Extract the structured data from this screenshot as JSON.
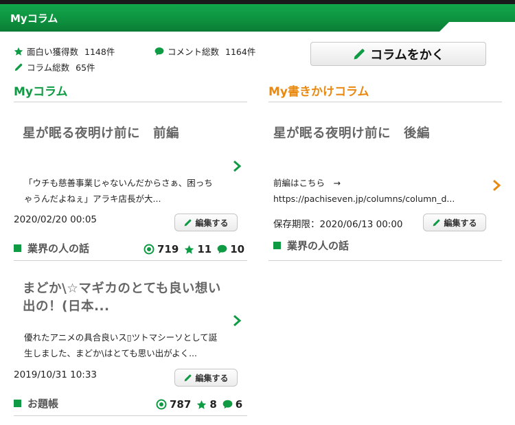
{
  "header": {
    "title": "Myコラム"
  },
  "stats": {
    "likes_label": "面白い獲得数",
    "likes_value": "1148件",
    "comments_label": "コメント総数",
    "comments_value": "1164件",
    "columns_label": "コラム総数",
    "columns_value": "65件"
  },
  "write_button": "コラムをかく",
  "my_columns": {
    "title": "Myコラム",
    "items": [
      {
        "title_line1": "星が眠る夜明け前に　前編",
        "title_line2": "",
        "excerpt_line1": "「ウチも慈善事業じゃないんだからさぁ、困っち",
        "excerpt_line2": "ゃうんだよねぇ」アラキ店長が大...",
        "date": "2020/02/20 00:05",
        "edit": "編集する",
        "category": "業界の人の話",
        "views": "719",
        "likes": "11",
        "comments": "10"
      },
      {
        "title_line1": "まどか\\☆マギカのとても良い想い",
        "title_line2": "出の！(日本...",
        "excerpt_line1": "優れたアニメの具合良いス▯ツトマシーソとして誕",
        "excerpt_line2": "生しました、まどか\\はとても思い出がよく...",
        "date": "2019/10/31 10:33",
        "edit": "編集する",
        "category": "お題帳",
        "views": "787",
        "likes": "8",
        "comments": "6"
      }
    ]
  },
  "drafts": {
    "title": "My書きかけコラム",
    "items": [
      {
        "title_line1": "星が眠る夜明け前に　後編",
        "excerpt_line1": "前編はこちら　→",
        "excerpt_line2": "https://pachiseven.jp/columns/column_d...",
        "date": "保存期限：2020/06/13 00:00",
        "edit": "編集する",
        "category": "業界の人の話"
      }
    ]
  },
  "colors": {
    "green": "#0f9a44",
    "orange": "#e88a12",
    "header": "#0e9340"
  },
  "icons": [
    "star-icon",
    "comment-icon",
    "pencil-icon",
    "chevron-right-icon",
    "view-icon"
  ]
}
